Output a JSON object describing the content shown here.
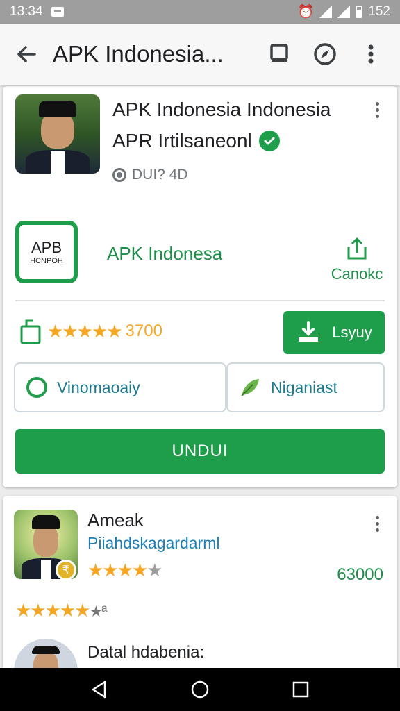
{
  "status_bar": {
    "time": "13:34",
    "battery": "152"
  },
  "app_bar": {
    "title": "APK Indonesia..."
  },
  "app_card": {
    "title": "APK Indonesia Indonesia",
    "subtitle": "APR Irtilsaneonl",
    "meta": "DUI? 4D",
    "logo_line1": "APB",
    "logo_line2": "HCNPOH",
    "brand_name": "APK Indonesa",
    "share_label": "Canokc",
    "rating_stars": "★★★★★",
    "rating_count": "3700",
    "install_label": "Lsyuy",
    "option_left": "Vinomaoaiy",
    "option_right": "Niganiast",
    "download_label": "UNDUI"
  },
  "related_card": {
    "name": "Ameak",
    "developer": "Piiahdskagardarml",
    "stars": "★★★★",
    "stars_grey": "★",
    "count": "63000",
    "stars2": "★★★★★",
    "stars2_tail": "★ª",
    "section": "Datal hdabenia:"
  },
  "colors": {
    "accent": "#1e9e4a",
    "star": "#f5a623",
    "link": "#1e7fb8"
  },
  "icons": [
    "back-arrow-icon",
    "bookmark-icon",
    "compass-icon",
    "more-vert-icon",
    "verified-check-icon",
    "share-icon",
    "download-tray-icon",
    "leaf-icon",
    "nav-back-icon",
    "nav-home-icon",
    "nav-recents-icon"
  ]
}
